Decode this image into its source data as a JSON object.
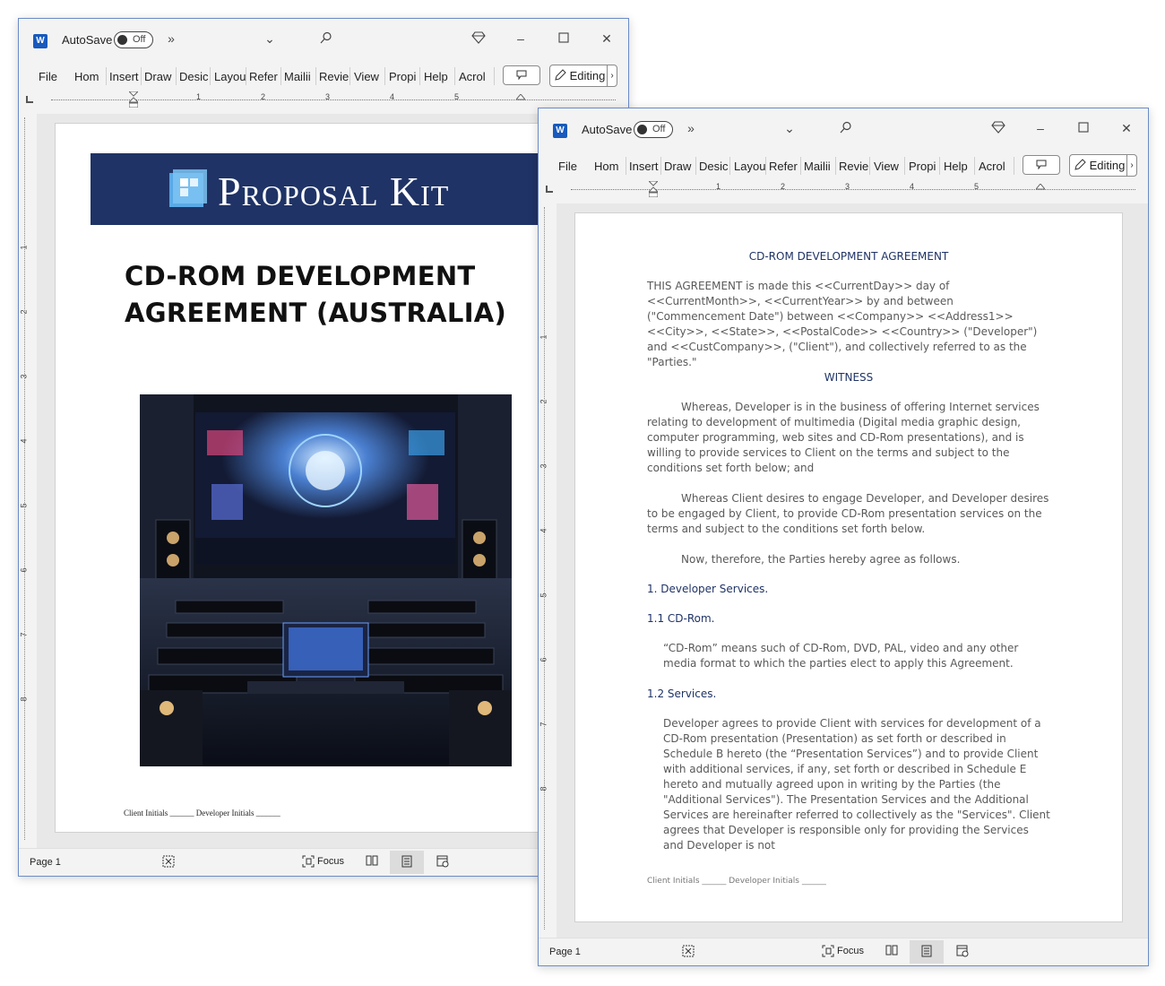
{
  "app": {
    "autosave_label": "AutoSave",
    "toggle_state": "Off",
    "tabs": [
      "File",
      "Hom",
      "Insert",
      "Draw",
      "Desic",
      "Layou",
      "Refer",
      "Mailii",
      "Revie",
      "View",
      "Propi",
      "Help",
      "Acrol"
    ],
    "editing_label": "Editing",
    "ruler_numbers": [
      "1",
      "2",
      "3",
      "4",
      "5"
    ],
    "vruler_numbers": [
      "1",
      "2",
      "3",
      "4",
      "5",
      "6",
      "7",
      "8"
    ],
    "status_page": "Page 1",
    "focus_label": "Focus"
  },
  "cover": {
    "logo_text": "Proposal Kit",
    "title_line1": "CD-ROM DEVELOPMENT",
    "title_line2": "AGREEMENT (AUSTRALIA)",
    "initials": "Client Initials ______ Developer Initials ______"
  },
  "agreement": {
    "title": "CD-ROM DEVELOPMENT AGREEMENT",
    "intro": "THIS AGREEMENT is made this <<CurrentDay>> day of <<CurrentMonth>>, <<CurrentYear>> by and between (\"Commencement Date\") between <<Company>> <<Address1>> <<City>>, <<State>>, <<PostalCode>> <<Country>> (\"Developer\") and <<CustCompany>>, (\"Client\"), and collectively referred to as the \"Parties.\"",
    "witness": "WITNESS",
    "whereas1": "Whereas, Developer is in the business of offering Internet services relating to development of multimedia (Digital media graphic design, computer programming, web sites and CD-Rom presentations), and is willing to provide services to Client on the terms and subject to the conditions set forth below; and",
    "whereas2": "Whereas Client desires to engage Developer, and Developer desires to be engaged by Client, to provide CD-Rom presentation services on the terms and subject to the conditions set forth below.",
    "now_therefore": "Now, therefore, the Parties hereby agree as follows.",
    "section1": "1. Developer Services.",
    "section1_1": "1.1 CD-Rom.",
    "section1_1_text": "“CD-Rom” means such of CD-Rom, DVD, PAL, video and any other media format to which the parties elect to apply this Agreement.",
    "section1_2": "1.2 Services.",
    "section1_2_text": "Developer agrees  to provide Client with services for development of a CD-Rom presentation (Presentation) as set forth or described in Schedule B hereto (the “Presentation Services”) and to provide Client with additional services, if any, set forth or described in Schedule E hereto and mutually agreed upon in writing by the Parties (the \"Additional Services\"). The Presentation Services and the Additional Services are hereinafter referred to collectively as the \"Services\". Client agrees that Developer is responsible only for providing the Services and Developer is not",
    "initials": "Client Initials ______ Developer Initials ______"
  },
  "colors": {
    "banner": "#1f3366",
    "word_blue": "#185abd",
    "window_border": "#6b8cc7"
  },
  "icons": [
    "word-icon",
    "more-icon",
    "chevron-down-icon",
    "search-icon",
    "diamond-icon",
    "minimize-icon",
    "maximize-icon",
    "close-icon",
    "comment-icon",
    "pencil-icon",
    "accessibility-icon",
    "focus-icon",
    "read-mode-icon",
    "print-layout-icon",
    "web-layout-icon"
  ]
}
